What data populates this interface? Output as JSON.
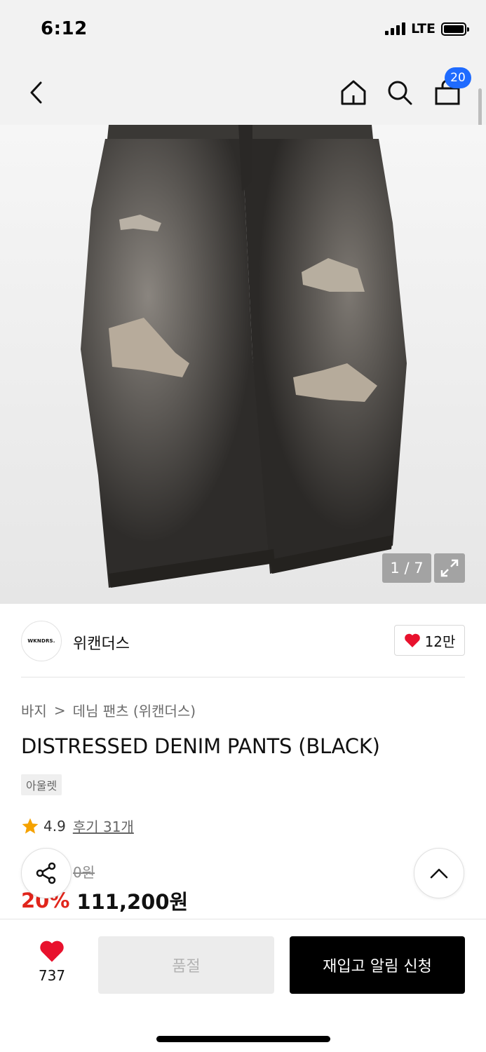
{
  "status_bar": {
    "time": "6:12",
    "network": "LTE"
  },
  "nav": {
    "back_icon": "chevron-left-icon",
    "home_icon": "home-icon",
    "search_icon": "search-icon",
    "cart_icon": "shopping-bag-icon",
    "cart_count": "20"
  },
  "gallery": {
    "counter": "1 / 7",
    "expand_icon": "expand-icon",
    "image_alt": "Black distressed denim pants"
  },
  "brand": {
    "logo_text": "WKNDRS.",
    "name": "위캔더스",
    "like_icon": "heart-icon",
    "like_count": "12만"
  },
  "breadcrumb": {
    "category": "바지",
    "separator": ">",
    "subcategory": "데님 팬츠 (위캔더스)"
  },
  "product": {
    "title": "DISTRESSED DENIM PANTS (BLACK)",
    "tag": "아울렛",
    "rating": "4.9",
    "review_link": "후기 31개",
    "original_price": "0원",
    "discount": "20%",
    "price": "111,200원"
  },
  "floating": {
    "share_icon": "share-icon",
    "top_icon": "chevron-up-icon"
  },
  "bottom_bar": {
    "wish_count": "737",
    "soldout_label": "품절",
    "restock_label": "재입고 알림 신청"
  },
  "colors": {
    "accent_red": "#e1251b",
    "badge_blue": "#1f6bff",
    "heart_red": "#e8112d"
  }
}
